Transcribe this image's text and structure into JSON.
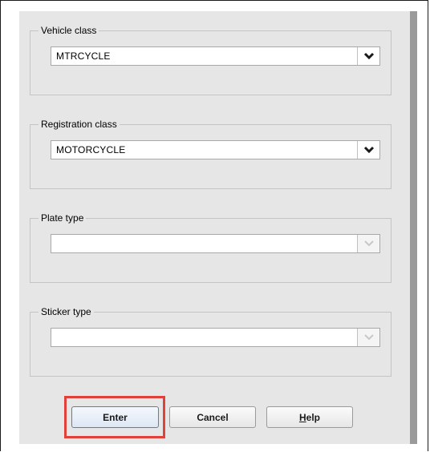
{
  "fields": [
    {
      "legend": "Vehicle class",
      "value": "MTRCYCLE",
      "enabled": true
    },
    {
      "legend": "Registration class",
      "value": "MOTORCYCLE",
      "enabled": true
    },
    {
      "legend": "Plate type",
      "value": "",
      "enabled": false
    },
    {
      "legend": "Sticker type",
      "value": "",
      "enabled": false
    }
  ],
  "buttons": {
    "enter": "Enter",
    "cancel": "Cancel",
    "help": "Help",
    "help_mnemonic": "H",
    "help_rest": "elp"
  },
  "colors": {
    "highlight": "#e0413a",
    "panel": "#e6e6e6"
  },
  "icons": {
    "dropdown": "chevron-down-icon"
  }
}
